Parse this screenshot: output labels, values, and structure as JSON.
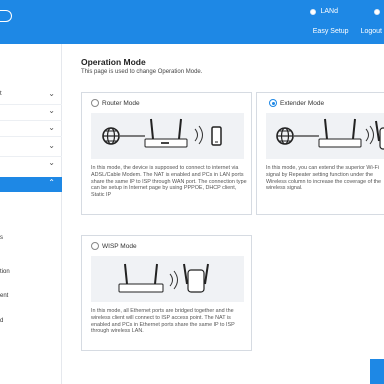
{
  "header": {
    "lang_label": "LANd",
    "nav": {
      "easy_setup": "Easy Setup",
      "logout": "Logout"
    }
  },
  "sidebar": {
    "items": [
      {
        "label": "t",
        "chevron": "⌄"
      },
      {
        "label": "",
        "chevron": "⌄"
      },
      {
        "label": "",
        "chevron": "⌄"
      },
      {
        "label": "",
        "chevron": "⌄"
      },
      {
        "label": "",
        "chevron": "⌄"
      },
      {
        "label": "",
        "chevron": "⌃"
      },
      {
        "label": "s",
        "chevron": ""
      },
      {
        "label": "tion",
        "chevron": ""
      },
      {
        "label": "ent",
        "chevron": ""
      },
      {
        "label": "d",
        "chevron": ""
      }
    ]
  },
  "main": {
    "title": "Operation Mode",
    "description": "This page is used to change Operation Mode.",
    "modes": [
      {
        "label": "Router Mode",
        "selected": false,
        "description": "In this mode, the device is supposed to connect to internet via ADSL/Cable Modem. The NAT is enabled and PCs in LAN ports share the same IP to ISP through WAN port. The connection type can be setup in Internet page by using PPPOE, DHCP client, Static IP"
      },
      {
        "label": "Extender Mode",
        "selected": true,
        "description": "In this mode, you can extend the superior Wi-Fi signal by Repeater setting function under the Wireless column to increase the coverage of the wireless signal."
      },
      {
        "label": "WISP Mode",
        "selected": false,
        "description": "In this mode, all Ethernet ports are bridged together and the wireless client will connect to ISP access point. The NAT is enabled and PCs in Ethernet ports share the same IP to ISP through wireless LAN."
      }
    ]
  },
  "colors": {
    "accent": "#1e88e5",
    "card_border": "#d6dbe2",
    "illustration_bg": "#f0f2f5"
  },
  "icons": [
    "logo-icon",
    "globe-icon",
    "router-icon",
    "phone-icon",
    "extender-icon",
    "chevron-down-icon",
    "chevron-up-icon"
  ]
}
